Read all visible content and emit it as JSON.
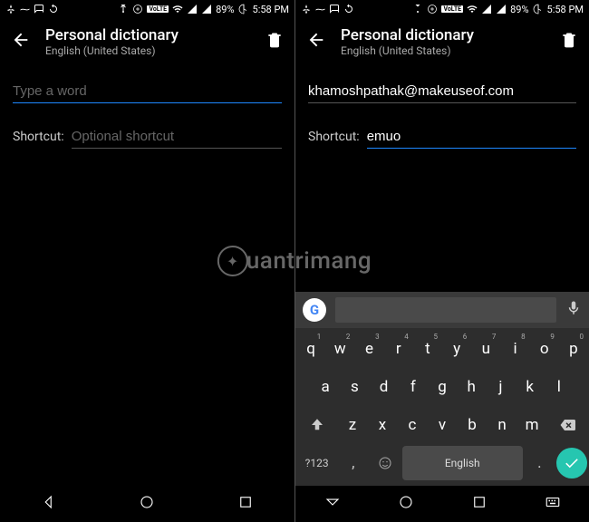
{
  "status": {
    "battery": "89%",
    "time": "5:58 PM",
    "volte": "VoLTE"
  },
  "left": {
    "header": {
      "title": "Personal dictionary",
      "subtitle": "English (United States)"
    },
    "word": {
      "value": "",
      "placeholder": "Type a word"
    },
    "shortcut": {
      "label": "Shortcut:",
      "value": "",
      "placeholder": "Optional shortcut"
    }
  },
  "right": {
    "header": {
      "title": "Personal dictionary",
      "subtitle": "English (United States)"
    },
    "word": {
      "value": "khamoshpathak@makeuseof.com",
      "placeholder": "Type a word"
    },
    "shortcut": {
      "label": "Shortcut:",
      "value": "emuo",
      "placeholder": "Optional shortcut"
    }
  },
  "keyboard": {
    "row1": [
      "q",
      "w",
      "e",
      "r",
      "t",
      "y",
      "u",
      "i",
      "o",
      "p"
    ],
    "row1sup": [
      "1",
      "2",
      "3",
      "4",
      "5",
      "6",
      "7",
      "8",
      "9",
      "0"
    ],
    "row2": [
      "a",
      "s",
      "d",
      "f",
      "g",
      "h",
      "j",
      "k",
      "l"
    ],
    "row3": [
      "z",
      "x",
      "c",
      "v",
      "b",
      "n",
      "m"
    ],
    "symKey": "?123",
    "comma": ",",
    "dot": ".",
    "space": "English"
  },
  "watermark": "uantrimang"
}
